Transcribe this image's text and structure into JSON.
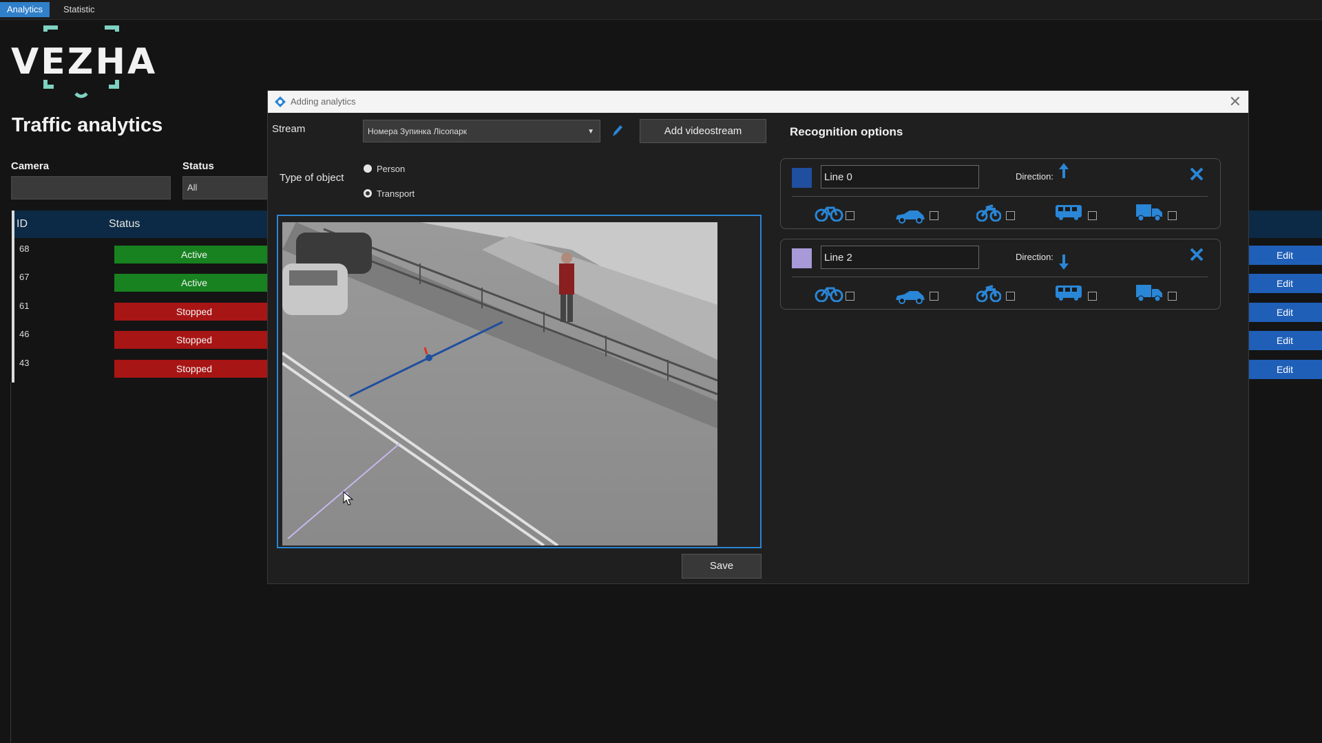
{
  "top_tabs": [
    {
      "label": "Analytics",
      "active": true
    },
    {
      "label": "Statistic",
      "active": false
    }
  ],
  "brand": {
    "logo_text": "VEZHA"
  },
  "page": {
    "title": "Traffic analytics"
  },
  "filters": {
    "camera_label": "Camera",
    "camera_value": "",
    "status_label": "Status",
    "status_value": "All"
  },
  "table": {
    "columns": [
      "ID",
      "Status"
    ],
    "rows": [
      {
        "id": "68",
        "status": "Active",
        "action": "Edit"
      },
      {
        "id": "67",
        "status": "Active",
        "action": "Edit"
      },
      {
        "id": "61",
        "status": "Stopped",
        "action": "Edit"
      },
      {
        "id": "46",
        "status": "Stopped",
        "action": "Edit"
      },
      {
        "id": "43",
        "status": "Stopped",
        "action": "Edit"
      }
    ]
  },
  "dialog": {
    "title": "Adding analytics",
    "stream_label": "Stream",
    "stream_value": "Номера Зупинка Лісопарк",
    "add_stream_button": "Add videostream",
    "type_label": "Type of object",
    "type_options": [
      {
        "label": "Person",
        "selected": false
      },
      {
        "label": "Transport",
        "selected": true
      }
    ],
    "save_button": "Save",
    "recognition_title": "Recognition options",
    "lines": [
      {
        "name": "Line 0",
        "color": "#1f4f9e",
        "direction_label": "Direction:",
        "direction": "up",
        "vehicles": [
          "bicycle-icon",
          "car-icon",
          "motorcycle-icon",
          "bus-icon",
          "truck-icon"
        ]
      },
      {
        "name": "Line 2",
        "color": "#a89ad8",
        "direction_label": "Direction:",
        "direction": "down",
        "vehicles": [
          "bicycle-icon",
          "car-icon",
          "motorcycle-icon",
          "bus-icon",
          "truck-icon"
        ]
      }
    ]
  },
  "colors": {
    "accent": "#2a86d6",
    "active": "#17821f",
    "stopped": "#a81515",
    "edit": "#1f5fb8"
  }
}
